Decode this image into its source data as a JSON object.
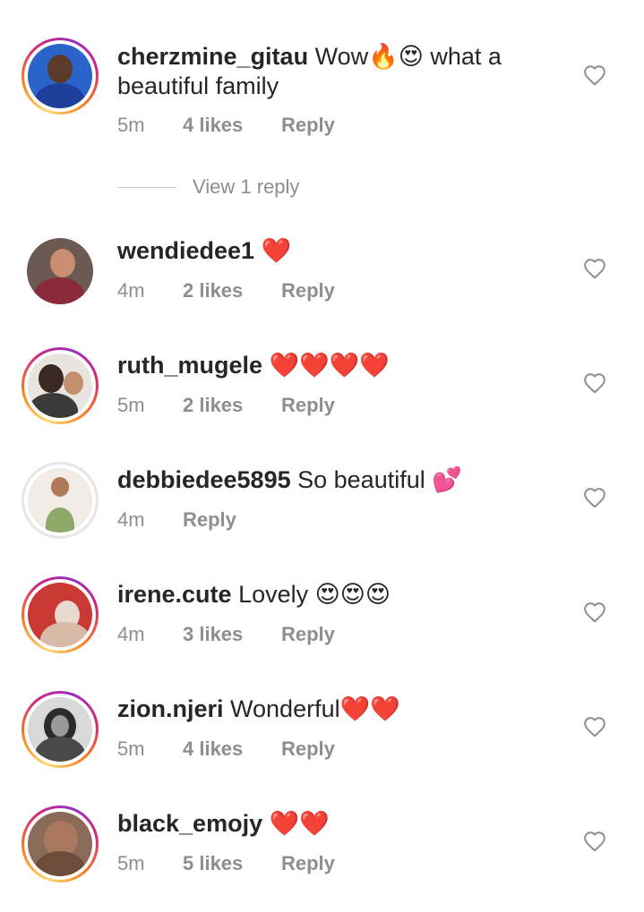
{
  "colors": {
    "text": "#262626",
    "secondary": "#8e8e8e",
    "heart_outline": "#8e8e8e"
  },
  "comments": [
    {
      "username": "cherzmine_gitau",
      "text": "Wow🔥😍 what a beautiful family",
      "time": "5m",
      "likes": "4 likes",
      "reply": "Reply"
    },
    {
      "username": "wendiedee1",
      "text": "❤️",
      "time": "4m",
      "likes": "2 likes",
      "reply": "Reply"
    },
    {
      "username": "ruth_mugele",
      "text": "❤️❤️❤️❤️",
      "time": "5m",
      "likes": "2 likes",
      "reply": "Reply"
    },
    {
      "username": "debbiedee5895",
      "text": "So beautiful 💕",
      "time": "4m",
      "likes": "",
      "reply": "Reply"
    },
    {
      "username": "irene.cute",
      "text": "Lovely 😍😍😍",
      "time": "4m",
      "likes": "3 likes",
      "reply": "Reply"
    },
    {
      "username": "zion.njeri",
      "text": "Wonderful❤️❤️",
      "time": "5m",
      "likes": "4 likes",
      "reply": "Reply"
    },
    {
      "username": "black_emojy",
      "text": "❤️❤️",
      "time": "5m",
      "likes": "5 likes",
      "reply": "Reply"
    }
  ],
  "view_replies_label": "View 1 reply",
  "icons": {
    "like": "heart-outline-icon"
  }
}
